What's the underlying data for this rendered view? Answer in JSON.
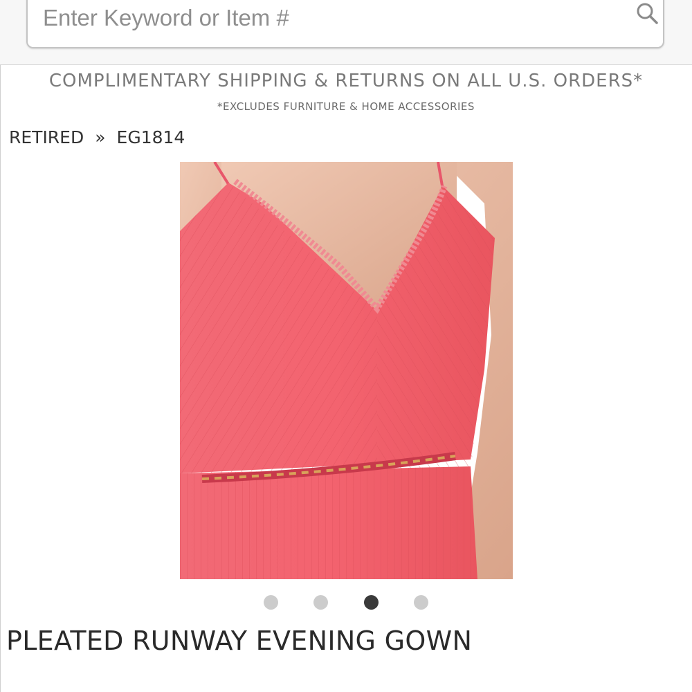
{
  "search": {
    "placeholder": "Enter Keyword or Item #",
    "value": ""
  },
  "promo": {
    "main": "COMPLIMENTARY SHIPPING & RETURNS ON ALL U.S. ORDERS*",
    "sub": "*EXCLUDES FURNITURE & HOME ACCESSORIES"
  },
  "breadcrumb": {
    "items": [
      "RETIRED",
      "EG1814"
    ],
    "separator": "»"
  },
  "product": {
    "title": "PLEATED RUNWAY EVENING GOWN",
    "image_count": 4,
    "active_image_index": 2,
    "image": {
      "subject": "coral pink pleated gown with spaghetti straps, lace V-neckline and beaded waist belt",
      "dress_color": "#f2616e",
      "skin_color": "#e8b9a0"
    }
  },
  "colors": {
    "promo_text": "#7a7a7a",
    "title_text": "#2a2a2a",
    "dot_inactive": "#cccccc",
    "dot_active": "#3a3a3a"
  },
  "icons": {
    "search": "search-icon"
  }
}
